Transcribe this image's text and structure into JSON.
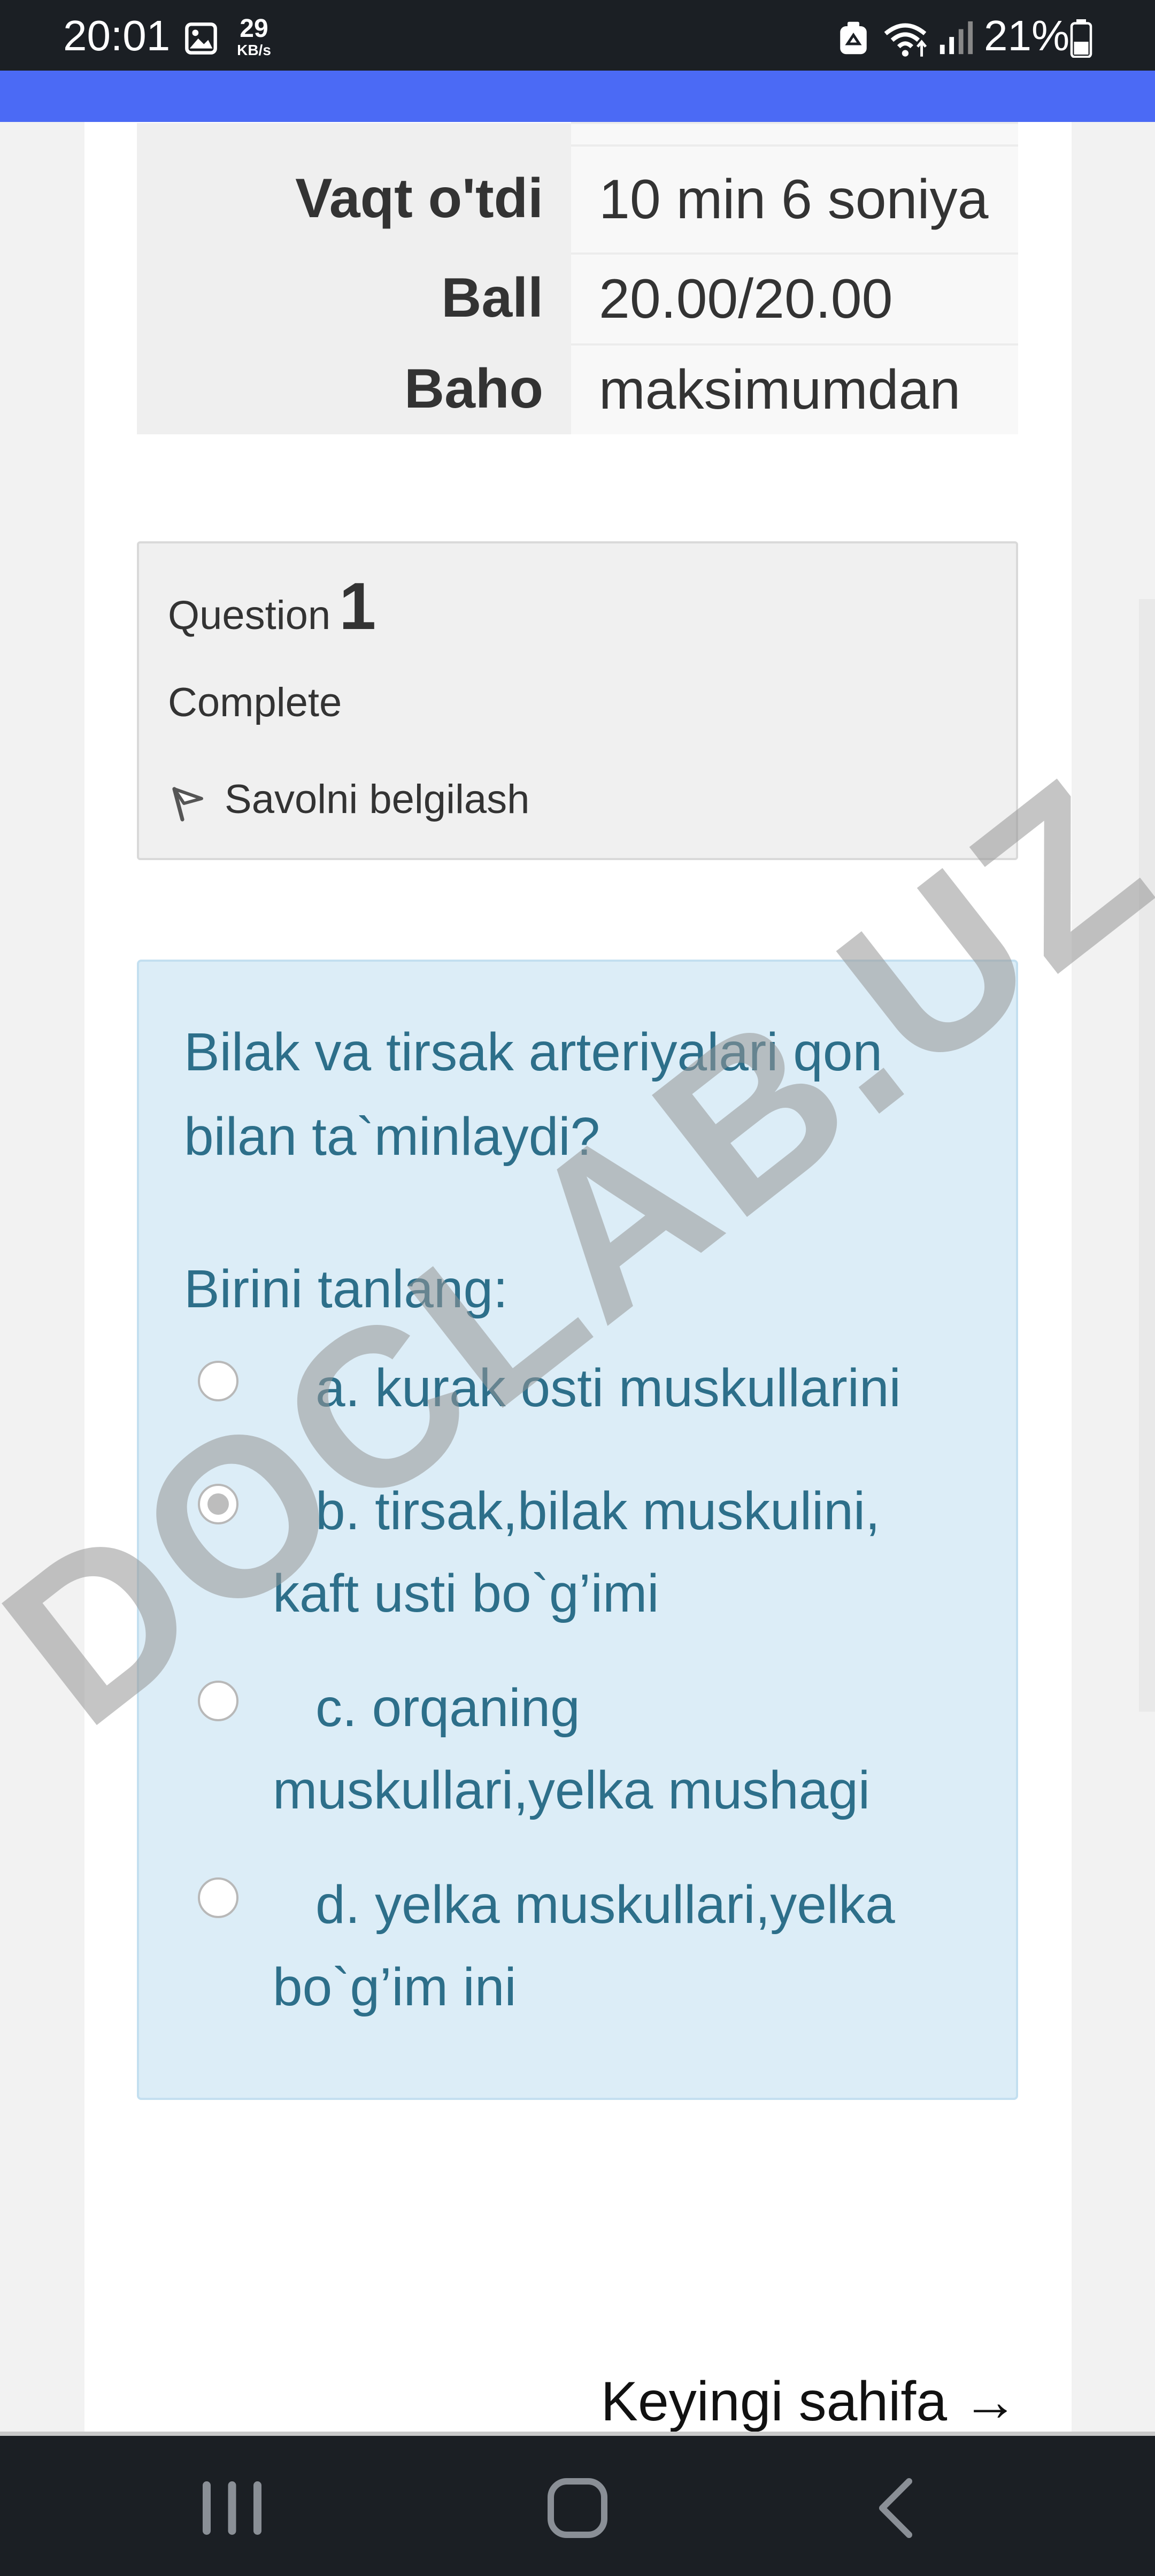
{
  "status_bar": {
    "time": "20:01",
    "net_speed_value": "29",
    "net_speed_unit": "KB/s",
    "battery_percent": "21%",
    "icons": [
      "gallery-icon",
      "recycle-icon",
      "wifi-icon",
      "signal-icon",
      "battery-icon"
    ]
  },
  "summary": {
    "rows": [
      {
        "label": "Vaqt o'tdi",
        "value": "10 min 6 soniya"
      },
      {
        "label": "Ball",
        "value": "20.00/20.00"
      },
      {
        "label": "Baho",
        "value": "maksimumdan"
      }
    ]
  },
  "question_info": {
    "question_word": "Question",
    "question_number": "1",
    "state": "Complete",
    "flag_label": "Savolni belgilash"
  },
  "question": {
    "text": "Bilak va tirsak arteriyalari qon bilan ta`minlaydi?",
    "prompt": "Birini tanlang:",
    "answers": [
      {
        "label": "a. kurak osti muskullarini",
        "selected": false
      },
      {
        "label": "b. tirsak,bilak muskulini, kaft usti bo`g’imi",
        "selected": true
      },
      {
        "label": "c. orqaning muskullari,yelka mushagi",
        "selected": false
      },
      {
        "label": "d. yelka muskullari,yelka bo`g’im ini",
        "selected": false
      }
    ]
  },
  "watermark": "DOCLAB.UZ",
  "navigation": {
    "next_label": "Keyingi sahifa →"
  },
  "colors": {
    "header_blue": "#4b6af5",
    "question_bg": "#dcedf7",
    "question_text": "#2d6f8a",
    "info_bg": "#f0f0f0"
  }
}
